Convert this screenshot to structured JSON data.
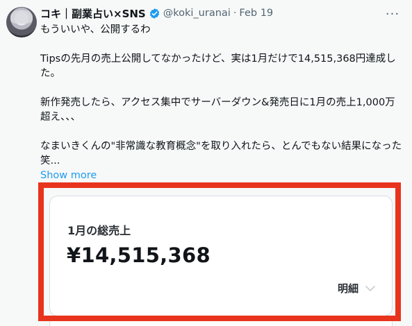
{
  "author": {
    "display_name": "コキ｜副業占い×SNS",
    "handle": "@koki_uranai",
    "date": "Feb 19",
    "verified": true,
    "avatar_icon": "avatar-image"
  },
  "tweet": {
    "lines": [
      "もういいや、公開するわ",
      "",
      "Tipsの先月の売上公開してなかったけど、実は1月だけで14,515,368円達成した。",
      "",
      "新作発売したら、アクセス集中でサーバーダウン&発売日に1月の売上1,000万超え、、、",
      "",
      "なまいきくんの\"非常識な教育概念\"を取り入れたら、とんでもない結果になった笑..."
    ],
    "show_more_label": "Show more"
  },
  "card": {
    "title": "1月の総売上",
    "amount": "¥14,515,368",
    "detail_label": "明細"
  },
  "colors": {
    "highlight": "#e8341d",
    "link": "#1d9bf0",
    "verified_badge": "#1d9bf0"
  }
}
